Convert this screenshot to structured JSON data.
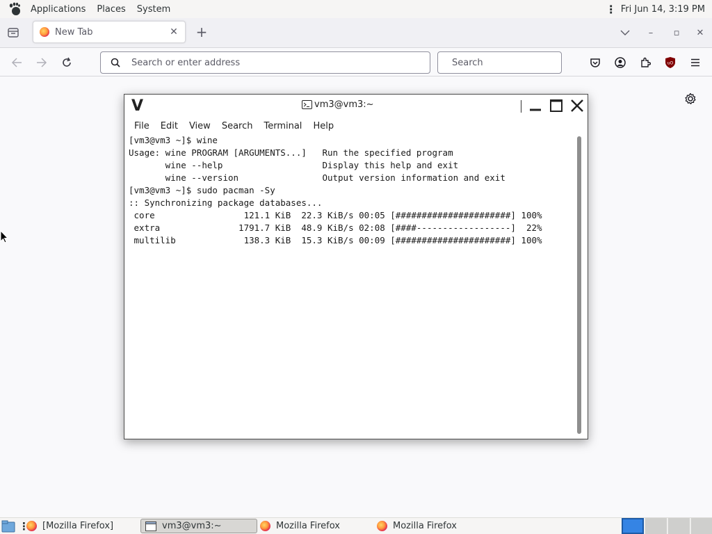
{
  "top_panel": {
    "menus": [
      "Applications",
      "Places",
      "System"
    ],
    "clock": "Fri Jun 14,  3:19 PM"
  },
  "browser": {
    "tab": {
      "title": "New Tab",
      "close": "✕"
    },
    "new_tab": "+",
    "window_controls": {
      "minimize": "–",
      "maximize": "▫",
      "close": "✕"
    },
    "url_placeholder": "Search or enter address",
    "search_placeholder": "Search"
  },
  "terminal": {
    "title": "vm3@vm3:~",
    "menu": [
      "File",
      "Edit",
      "View",
      "Search",
      "Terminal",
      "Help"
    ],
    "lines": [
      "[vm3@vm3 ~]$ wine",
      "Usage: wine PROGRAM [ARGUMENTS...]   Run the specified program",
      "       wine --help                   Display this help and exit",
      "       wine --version                Output version information and exit",
      "[vm3@vm3 ~]$ sudo pacman -Sy",
      ":: Synchronizing package databases...",
      " core                 121.1 KiB  22.3 KiB/s 00:05 [######################] 100%",
      " extra               1791.7 KiB  48.9 KiB/s 02:08 [####------------------]  22%",
      " multilib             138.3 KiB  15.3 KiB/s 00:09 [######################] 100%"
    ],
    "downloads": [
      {
        "repo": "core",
        "size": "121.1 KiB",
        "speed": "22.3 KiB/s",
        "time": "00:05",
        "percent": 100
      },
      {
        "repo": "extra",
        "size": "1791.7 KiB",
        "speed": "48.9 KiB/s",
        "time": "02:08",
        "percent": 22
      },
      {
        "repo": "multilib",
        "size": "138.3 KiB",
        "speed": "15.3 KiB/s",
        "time": "00:09",
        "percent": 100
      }
    ]
  },
  "taskbar": {
    "items": [
      "[Mozilla Firefox]",
      "vm3@vm3:~",
      "Mozilla Firefox",
      "Mozilla Firefox"
    ],
    "active_item": "vm3@vm3:~",
    "workspaces": 4,
    "active_workspace": 1
  },
  "colors": {
    "workspace_active": "#3584e4",
    "ublock": "#800000",
    "page_background": "#f9f9fb"
  }
}
